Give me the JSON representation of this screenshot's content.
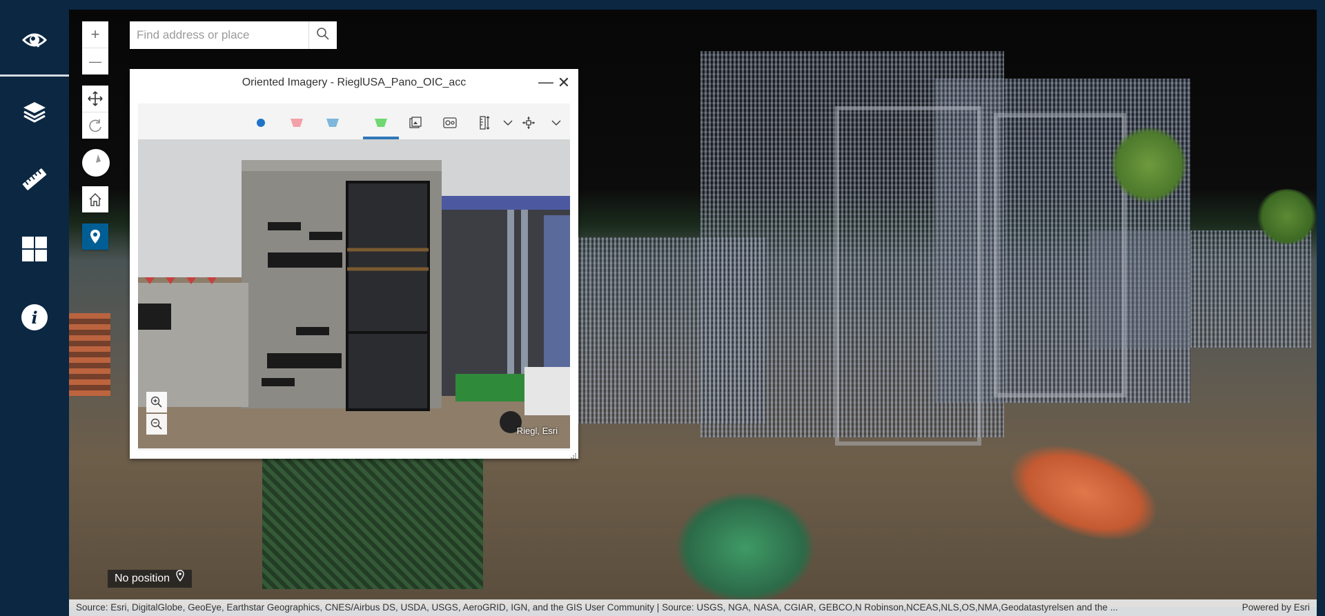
{
  "rail": {
    "items": [
      {
        "name": "app-logo-icon"
      },
      {
        "name": "layers-icon"
      },
      {
        "name": "measure-ruler-icon"
      },
      {
        "name": "basemap-gallery-icon"
      },
      {
        "name": "info-icon"
      }
    ]
  },
  "map_controls": {
    "zoom_in": "+",
    "zoom_out": "—"
  },
  "search": {
    "placeholder": "Find address or place"
  },
  "oriented_imagery": {
    "title": "Oriented Imagery - RieglUSA_Pano_OIC_acc",
    "minimize": "—",
    "close": "✕",
    "toolbar": {
      "icons": [
        "camera-location-icon",
        "footprint-pink-icon",
        "footprint-blue-icon",
        "footprint-green-icon",
        "image-gallery-icon",
        "image-enhance-icon",
        "measure-height-icon",
        "chevron-down-icon",
        "navigation-move-icon",
        "chevron-down-icon"
      ],
      "active_index": 3,
      "colors": {
        "dot": "#1f74c6",
        "pink": "#f4a0a8",
        "blue": "#7fb6dc",
        "green": "#70d870",
        "active": "#2f76b8"
      }
    },
    "image_attribution": "Riegl, Esri"
  },
  "status": {
    "no_position": "No position"
  },
  "attribution": {
    "sources": "Source: Esri, DigitalGlobe, GeoEye, Earthstar Geographics, CNES/Airbus DS, USDA, USGS, AeroGRID, IGN, and the GIS User Community | Source: USGS, NGA, NASA, CGIAR, GEBCO,N Robinson,NCEAS,NLS,OS,NMA,Geodatastyrelsen and the ...",
    "powered_by": "Powered by Esri"
  },
  "colors": {
    "rail_bg": "#0b2742",
    "accent": "#005e95"
  }
}
